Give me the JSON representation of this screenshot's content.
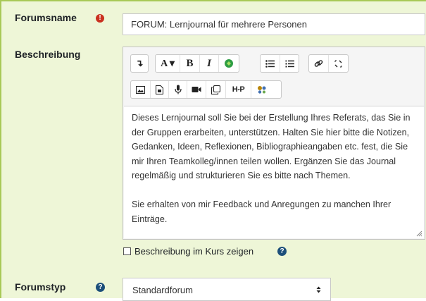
{
  "form": {
    "forumname": {
      "label": "Forumsname",
      "value": "FORUM: Lernjournal für mehrere Personen",
      "required_symbol": "!"
    },
    "description": {
      "label": "Beschreibung",
      "paragraph1": "Dieses Lernjournal soll Sie bei der Erstellung Ihres Referats, das Sie in der Gruppen erarbeiten, unterstützen. Halten Sie hier bitte die Notizen, Gedanken, Ideen, Reflexionen, Bibliographieangaben etc. fest, die Sie mir Ihren Teamkolleg/innen teilen wollen. Ergänzen Sie das Journal regelmäßig und strukturieren Sie es bitte nach Themen.",
      "paragraph2": "Sie erhalten von mir Feedback und Anregungen zu manchen Ihrer Einträge."
    },
    "toolbar": {
      "row1": {
        "collapse": "↴",
        "font": "A ▾",
        "bold": "B",
        "italic": "I"
      },
      "row2": {
        "h5p": "H-P"
      }
    },
    "show_description": {
      "label": "Beschreibung im Kurs zeigen",
      "checked": false
    },
    "forumtype": {
      "label": "Forumstyp",
      "selected": "Standardforum"
    }
  },
  "help_symbol": "?",
  "colors": {
    "form_background": "#eef6d7",
    "border_accent": "#a8c957",
    "required": "#ca3120",
    "help": "#1c4f7a"
  }
}
